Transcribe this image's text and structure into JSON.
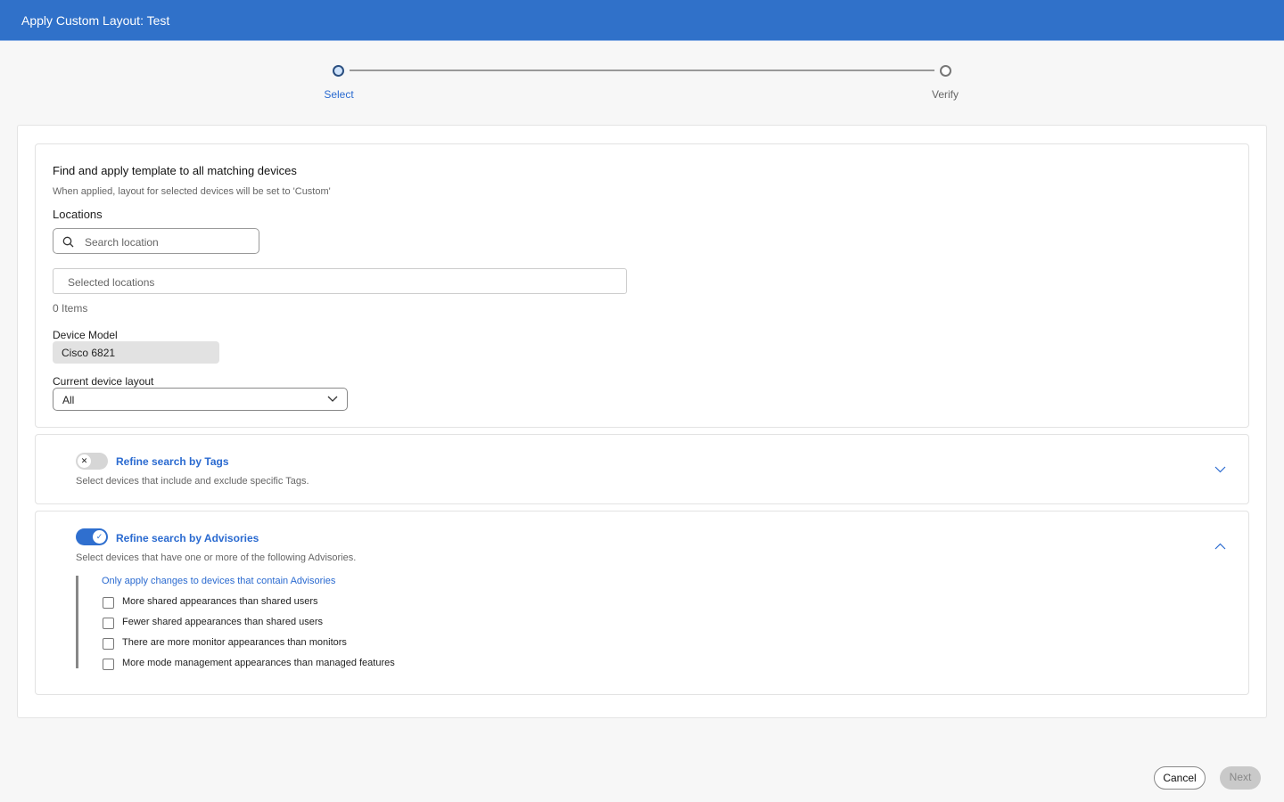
{
  "header": {
    "title": "Apply Custom Layout: Test"
  },
  "stepper": {
    "steps": [
      {
        "label": "Select",
        "active": true
      },
      {
        "label": "Verify",
        "active": false
      }
    ]
  },
  "main": {
    "title": "Find and apply template to all matching devices",
    "subtitle": "When applied, layout for selected devices will be set to 'Custom'",
    "locations_label": "Locations",
    "search_placeholder": "Search location",
    "selected_placeholder": "Selected locations",
    "items_count": "0 Items",
    "device_model_label": "Device Model",
    "device_model_value": "Cisco 6821",
    "layout_label": "Current device layout",
    "layout_value": "All"
  },
  "tags": {
    "title": "Refine search by Tags",
    "description": "Select devices that include and exclude specific Tags.",
    "enabled": false,
    "expanded": false
  },
  "advisories": {
    "title": "Refine search by Advisories",
    "description": "Select devices that have one or more of the following Advisories.",
    "enabled": true,
    "expanded": true,
    "note": "Only apply changes to devices that contain Advisories",
    "options": [
      {
        "label": "More shared appearances than shared users",
        "checked": false
      },
      {
        "label": "Fewer shared appearances than shared users",
        "checked": false
      },
      {
        "label": "There are more monitor appearances than monitors",
        "checked": false
      },
      {
        "label": "More mode management appearances than managed features",
        "checked": false
      }
    ]
  },
  "footer": {
    "cancel": "Cancel",
    "next": "Next"
  },
  "colors": {
    "accent": "#3071c9",
    "link": "#2a6ad0"
  }
}
